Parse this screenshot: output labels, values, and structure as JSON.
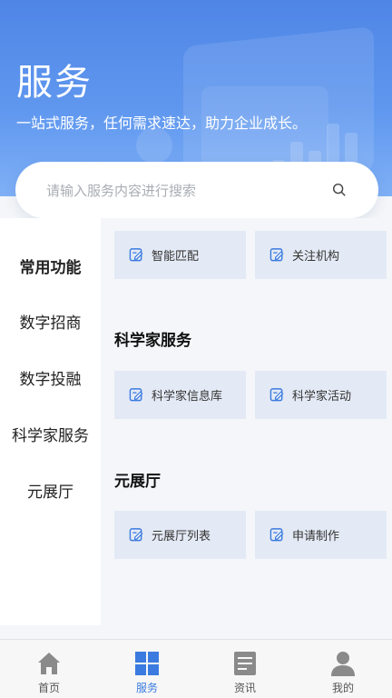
{
  "header": {
    "title": "服务",
    "subtitle": "一站式服务，任何需求速达，助力企业成长。"
  },
  "search": {
    "placeholder": "请输入服务内容进行搜索",
    "icon": "search-icon"
  },
  "sidebar": {
    "items": [
      {
        "label": "常用功能",
        "active": true
      },
      {
        "label": "数字招商",
        "active": false
      },
      {
        "label": "数字投融",
        "active": false
      },
      {
        "label": "科学家服务",
        "active": false
      },
      {
        "label": "元展厅",
        "active": false
      }
    ]
  },
  "sections": [
    {
      "title": "",
      "items": [
        {
          "label": "智能匹配",
          "icon": "edit-icon"
        },
        {
          "label": "关注机构",
          "icon": "edit-icon"
        }
      ]
    },
    {
      "title": "科学家服务",
      "items": [
        {
          "label": "科学家信息库",
          "icon": "edit-icon"
        },
        {
          "label": "科学家活动",
          "icon": "edit-icon"
        }
      ]
    },
    {
      "title": "元展厅",
      "items": [
        {
          "label": "元展厅列表",
          "icon": "edit-icon"
        },
        {
          "label": "申请制作",
          "icon": "edit-icon"
        }
      ]
    }
  ],
  "tabbar": {
    "items": [
      {
        "label": "首页",
        "icon": "home-icon",
        "active": false
      },
      {
        "label": "服务",
        "icon": "grid-icon",
        "active": true
      },
      {
        "label": "资讯",
        "icon": "news-icon",
        "active": false
      },
      {
        "label": "我的",
        "icon": "user-icon",
        "active": false
      }
    ]
  },
  "colors": {
    "accent": "#3b7be0",
    "hero": "#5f97ef",
    "card": "#e4eaf5"
  }
}
